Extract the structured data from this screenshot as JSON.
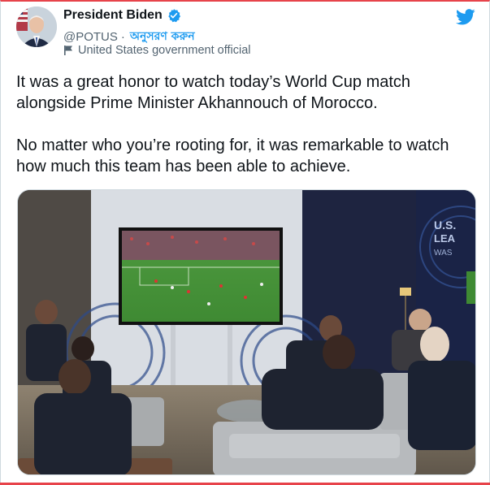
{
  "author": {
    "name": "President Biden",
    "handle": "@POTUS",
    "separator": "·",
    "follow_label": "অনুসরণ করুন",
    "affiliation": "United States government official",
    "verified_icon": "verified-badge-icon",
    "affiliation_icon": "flag-icon"
  },
  "tweet": {
    "paragraph1": "It was a great honor to watch today’s World Cup match alongside Prime Minister Akhannouch of Morocco.",
    "paragraph2": "No matter who you’re rooting for, it was remarkable to watch how much this team has been able to achieve."
  },
  "media": {
    "wall_sign": "U.S. LEA WAS"
  },
  "colors": {
    "accent": "#1d9bf0",
    "frame_red": "#e7434a"
  }
}
